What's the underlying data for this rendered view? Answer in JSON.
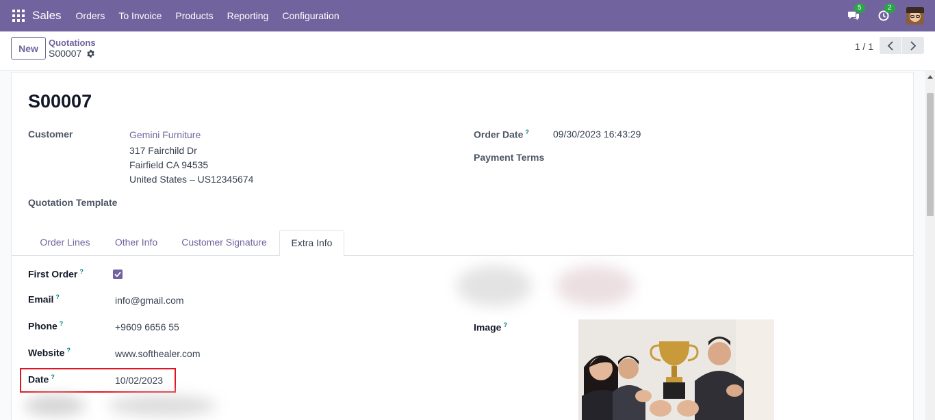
{
  "navbar": {
    "app_name": "Sales",
    "menu": [
      "Orders",
      "To Invoice",
      "Products",
      "Reporting",
      "Configuration"
    ],
    "messages_count": "5",
    "activities_count": "2",
    "color": "#71639e"
  },
  "control": {
    "new_label": "New",
    "breadcrumb_parent": "Quotations",
    "breadcrumb_current": "S00007",
    "pager_value": "1 / 1"
  },
  "record": {
    "name": "S00007",
    "customer_label": "Customer",
    "customer_name": "Gemini Furniture",
    "address_line1": "317 Fairchild Dr",
    "address_line2": "Fairfield CA 94535",
    "address_line3": "United States – US12345674",
    "template_label": "Quotation Template",
    "order_date_label": "Order Date",
    "order_date_value": "09/30/2023 16:43:29",
    "payment_terms_label": "Payment Terms"
  },
  "tabs": [
    "Order Lines",
    "Other Info",
    "Customer Signature",
    "Extra Info"
  ],
  "active_tab": "Extra Info",
  "extra_info": {
    "first_order_label": "First Order",
    "first_order_checked": true,
    "email_label": "Email",
    "email_value": "info@gmail.com",
    "phone_label": "Phone",
    "phone_value": "+9609 6656 55",
    "website_label": "Website",
    "website_value": "www.softhealer.com",
    "date_label": "Date",
    "date_value": "10/02/2023",
    "image_label": "Image"
  },
  "tooltip_mark": "?",
  "icons": {
    "apps": "apps-grid-icon",
    "messages": "chat-icon",
    "activities": "clock-icon",
    "settings": "gear-icon",
    "prev": "chevron-left-icon",
    "next": "chevron-right-icon"
  }
}
